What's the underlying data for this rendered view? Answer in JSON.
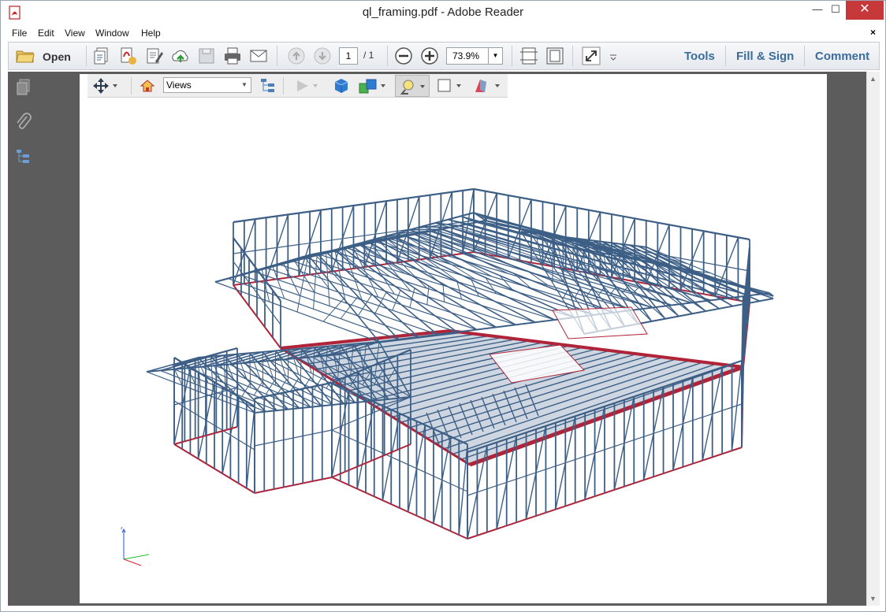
{
  "window": {
    "title": "ql_framing.pdf - Adobe Reader",
    "minimize": "—",
    "maximize": "☐",
    "close": "✕"
  },
  "menu": {
    "items": [
      "File",
      "Edit",
      "View",
      "Window",
      "Help"
    ],
    "close_doc": "×"
  },
  "toolbar": {
    "open_label": "Open",
    "page_current": "1",
    "page_total": "/ 1",
    "zoom": "73.9%",
    "tools_label": "Tools",
    "fill_sign_label": "Fill & Sign",
    "comment_label": "Comment"
  },
  "toolbar3d": {
    "views_label": "Views"
  },
  "colors": {
    "accent": "#3a6d9b",
    "frame": "#3d5f86",
    "base": "#b0243a",
    "close": "#c7383a"
  }
}
